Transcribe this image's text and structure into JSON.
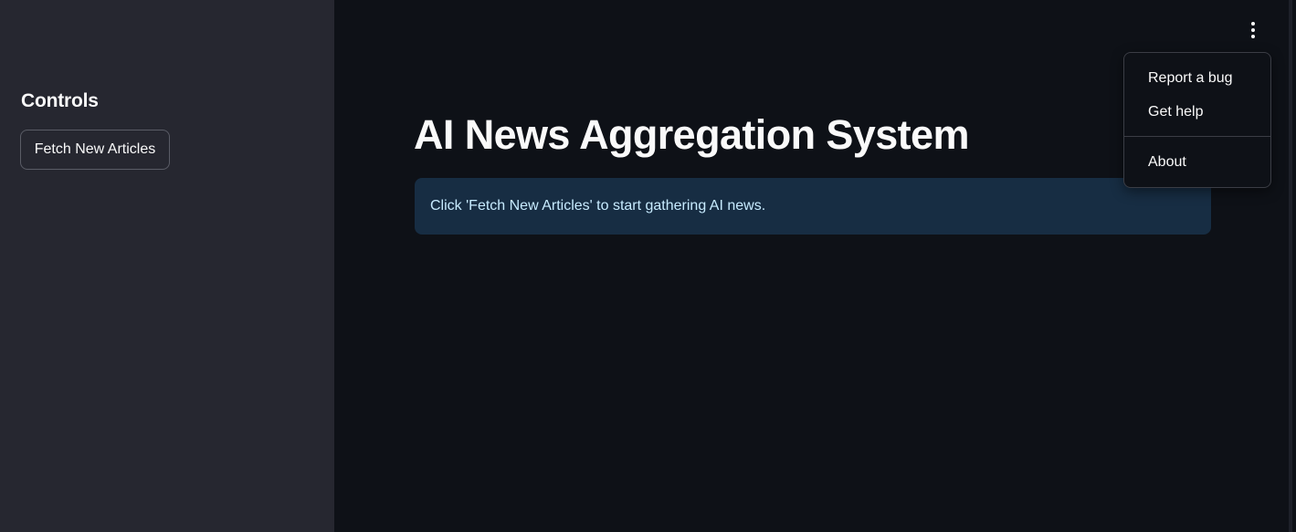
{
  "sidebar": {
    "heading": "Controls",
    "fetch_button_label": "Fetch New Articles"
  },
  "main": {
    "title": "AI News Aggregation System",
    "info_message": "Click 'Fetch New Articles' to start gathering AI news."
  },
  "app_menu": {
    "trigger_icon": "kebab-vertical-icon",
    "items": [
      {
        "label": "Report a bug"
      },
      {
        "label": "Get help"
      },
      {
        "label": "About"
      }
    ]
  },
  "colors": {
    "sidebar_bg": "#262730",
    "main_bg": "#0e1117",
    "info_bg": "#172d43",
    "info_text": "#c7ebff",
    "text": "#fafafa"
  }
}
